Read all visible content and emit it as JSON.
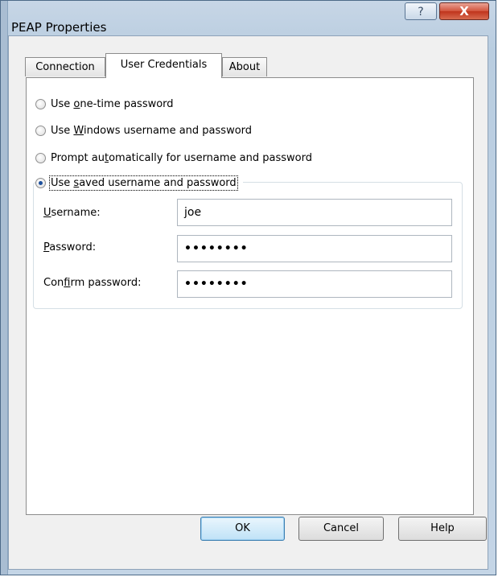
{
  "window": {
    "title": "PEAP Properties",
    "help_glyph": "?",
    "close_glyph": "X"
  },
  "tabs": [
    {
      "label": "Connection",
      "active": false
    },
    {
      "label": "User Credentials",
      "active": true
    },
    {
      "label": "About",
      "active": false
    }
  ],
  "options": [
    {
      "label_pre": "Use ",
      "label_key": "o",
      "label_post": "ne-time password",
      "checked": false
    },
    {
      "label_pre": "Use ",
      "label_key": "W",
      "label_post": "indows username and password",
      "checked": false
    },
    {
      "label_pre": "Prompt au",
      "label_key": "t",
      "label_post": "omatically for username and password",
      "checked": false
    },
    {
      "label_pre": "Use ",
      "label_key": "s",
      "label_post": "aved username and password",
      "checked": true
    }
  ],
  "fields": {
    "username": {
      "label_key": "U",
      "label_post": "sername:",
      "value": "joe"
    },
    "password": {
      "label_key": "P",
      "label_post": "assword:",
      "value": "••••••••"
    },
    "confirm": {
      "label_pre": "Con",
      "label_key": "f",
      "label_post": "irm password:",
      "value": "••••••••"
    }
  },
  "buttons": {
    "ok": "OK",
    "cancel": "Cancel",
    "help": "Help"
  },
  "colors": {
    "title_gradient": "#c7d6e6",
    "close_button": "#c0341c",
    "default_button_border": "#3c7fb1",
    "radio_dot": "#1c4f9c"
  }
}
